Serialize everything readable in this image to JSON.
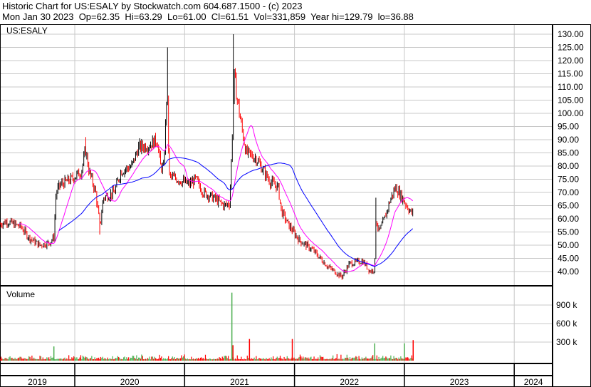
{
  "header": {
    "title": "Historic Chart for US:ESALY by Stockwatch.com 604.687.1500 - (c) 2023",
    "quote": "Mon Jan 30 2023  Op=62.35  Hi=63.29  Lo=61.00  Cl=61.51  Vol=331,859  Year hi=129.79  lo=36.88"
  },
  "chart_data": {
    "type": "candlestick",
    "symbol_label": "US:ESALY",
    "volume_label": "Volume",
    "price_ticks": [
      "130.00",
      "125.00",
      "120.00",
      "115.00",
      "110.00",
      "105.00",
      "100.00",
      "95.00",
      "90.00",
      "85.00",
      "80.00",
      "75.00",
      "70.00",
      "65.00",
      "60.00",
      "55.00",
      "50.00",
      "45.00",
      "40.00"
    ],
    "price_range": [
      37,
      131
    ],
    "volume_ticks": [
      {
        "v": 900000,
        "label": "900 k"
      },
      {
        "v": 600000,
        "label": "600 k"
      },
      {
        "v": 300000,
        "label": "300 k"
      }
    ],
    "years": [
      "2019",
      "2020",
      "2021",
      "2022",
      "2023",
      "2024"
    ],
    "price_path": [
      [
        2019.32,
        58
      ],
      [
        2019.38,
        59
      ],
      [
        2019.51,
        57
      ],
      [
        2019.58,
        53
      ],
      [
        2019.68,
        50
      ],
      [
        2019.77,
        51
      ],
      [
        2019.81,
        53
      ],
      [
        2019.83,
        70
      ],
      [
        2019.87,
        73
      ],
      [
        2019.97,
        75
      ],
      [
        2020.06,
        78
      ],
      [
        2020.1,
        86
      ],
      [
        2020.13,
        78
      ],
      [
        2020.19,
        70
      ],
      [
        2020.23,
        57
      ],
      [
        2020.26,
        68
      ],
      [
        2020.36,
        70
      ],
      [
        2020.42,
        78
      ],
      [
        2020.52,
        80
      ],
      [
        2020.58,
        87
      ],
      [
        2020.68,
        88
      ],
      [
        2020.75,
        90
      ],
      [
        2020.78,
        80
      ],
      [
        2020.81,
        79
      ],
      [
        2020.84,
        110
      ],
      [
        2020.86,
        76
      ],
      [
        2020.94,
        75
      ],
      [
        2021.04,
        73
      ],
      [
        2021.1,
        75
      ],
      [
        2021.17,
        70
      ],
      [
        2021.26,
        68
      ],
      [
        2021.36,
        65
      ],
      [
        2021.41,
        66
      ],
      [
        2021.43,
        87
      ],
      [
        2021.45,
        115
      ],
      [
        2021.47,
        108
      ],
      [
        2021.51,
        97
      ],
      [
        2021.56,
        85
      ],
      [
        2021.65,
        83
      ],
      [
        2021.72,
        78
      ],
      [
        2021.78,
        74
      ],
      [
        2021.85,
        72
      ],
      [
        2021.88,
        63
      ],
      [
        2021.94,
        58
      ],
      [
        2022.04,
        52
      ],
      [
        2022.17,
        48
      ],
      [
        2022.3,
        42
      ],
      [
        2022.43,
        38
      ],
      [
        2022.5,
        43
      ],
      [
        2022.62,
        44
      ],
      [
        2022.69,
        40
      ],
      [
        2022.73,
        41
      ],
      [
        2022.74,
        60
      ],
      [
        2022.77,
        55
      ],
      [
        2022.82,
        60
      ],
      [
        2022.87,
        67
      ],
      [
        2022.92,
        72
      ],
      [
        2022.98,
        68
      ],
      [
        2023.05,
        63
      ],
      [
        2023.08,
        61.51
      ]
    ],
    "volume_spikes": [
      [
        2019.81,
        230000,
        "up"
      ],
      [
        2021.43,
        1100000,
        "up"
      ],
      [
        2021.44,
        250000,
        "down"
      ],
      [
        2021.59,
        350000,
        "down"
      ],
      [
        2021.98,
        350000,
        "down"
      ],
      [
        2022.73,
        280000,
        "up"
      ],
      [
        2023.0,
        280000,
        "up"
      ],
      [
        2023.08,
        331859,
        "down"
      ]
    ],
    "ma_short_periods": 20,
    "ma_long_periods": 60,
    "colors": {
      "up": "#000000",
      "down": "#ff0000",
      "vol_up": "#4caf50",
      "vol_down": "#ff0000",
      "ma_short": "#ff00ff",
      "ma_long": "#0000ff",
      "grid": "#c8c8c8"
    }
  }
}
